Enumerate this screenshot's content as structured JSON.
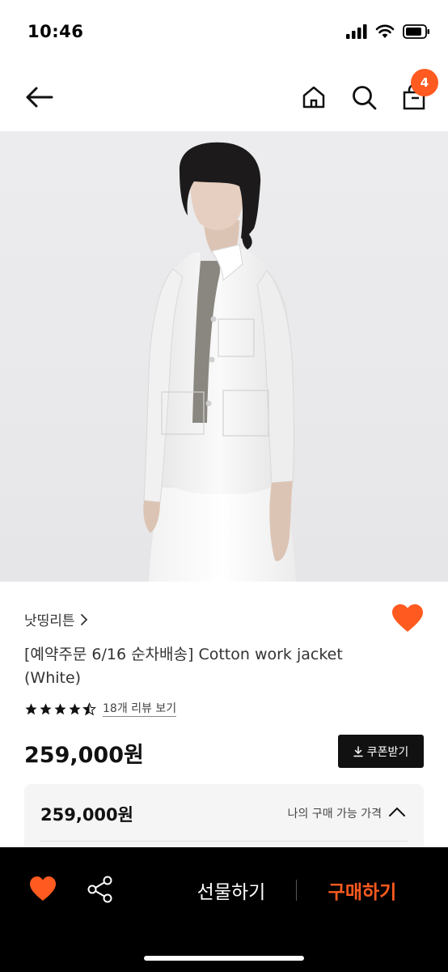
{
  "status": {
    "time": "10:46"
  },
  "nav": {
    "cart_count": "4"
  },
  "product": {
    "brand": "낫띵리튼",
    "title": "[예약주문 6/16 순차배송] Cotton work jacket (White)",
    "rating": 4.5,
    "review_link": "18개 리뷰 보기",
    "price": "259,000원",
    "coupon_label": "쿠폰받기"
  },
  "price_box": {
    "amount": "259,000원",
    "label": "나의 구매 가능 가격"
  },
  "bottom_bar": {
    "gift_label": "선물하기",
    "buy_label": "구매하기"
  },
  "colors": {
    "accent": "#ff5a1f",
    "dark": "#111111"
  }
}
